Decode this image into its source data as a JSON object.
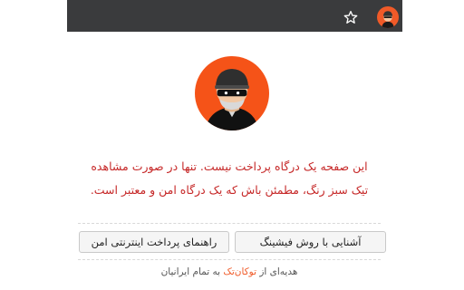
{
  "browser": {
    "icons": [
      "star-icon",
      "extension-avatar-icon"
    ]
  },
  "colors": {
    "accent": "#f55318",
    "warning_text": "#c62828",
    "browser_bar": "#3a3b3d"
  },
  "main": {
    "avatar_icon": "hacker-avatar-icon",
    "warning_line1": "این صفحه یک درگاه پرداخت نیست. تنها در صورت مشاهده",
    "warning_line2": "تیک سبز رنگ، مطمئن باش که یک درگاه امن و معتبر است.",
    "buttons": {
      "phishing_label": "آشنایی با روش فیشینگ",
      "guide_label": "راهنمای پرداخت اینترنتی امن"
    }
  },
  "footer": {
    "prefix": "هدیه‌ای از",
    "brand": "توکان‌تک",
    "suffix": "به تمام ایرانیان"
  }
}
